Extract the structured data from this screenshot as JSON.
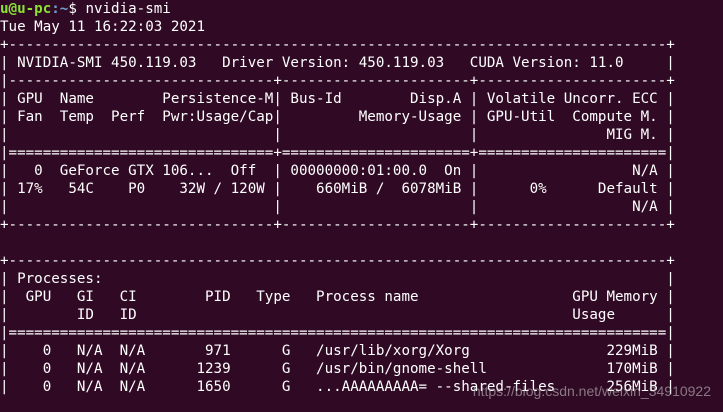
{
  "prompt": {
    "user_host": "u@u-pc",
    "path_symbol": ":~",
    "dollar": "$ ",
    "command": "nvidia-smi"
  },
  "lines": [
    "Tue May 11 16:22:03 2021",
    "+-----------------------------------------------------------------------------+",
    "| NVIDIA-SMI 450.119.03   Driver Version: 450.119.03   CUDA Version: 11.0     |",
    "|-------------------------------+----------------------+----------------------+",
    "| GPU  Name        Persistence-M| Bus-Id        Disp.A | Volatile Uncorr. ECC |",
    "| Fan  Temp  Perf  Pwr:Usage/Cap|         Memory-Usage | GPU-Util  Compute M. |",
    "|                               |                      |               MIG M. |",
    "|===============================+======================+======================|",
    "|   0  GeForce GTX 106...  Off  | 00000000:01:00.0  On |                  N/A |",
    "| 17%   54C    P0    32W / 120W |    660MiB /  6078MiB |      0%      Default |",
    "|                               |                      |                  N/A |",
    "+-------------------------------+----------------------+----------------------+",
    "",
    "+-----------------------------------------------------------------------------+",
    "| Processes:                                                                  |",
    "|  GPU   GI   CI        PID   Type   Process name                  GPU Memory |",
    "|        ID   ID                                                   Usage      |",
    "|=============================================================================|",
    "|    0   N/A  N/A       971      G   /usr/lib/xorg/Xorg                229MiB |",
    "|    0   N/A  N/A      1239      G   /usr/bin/gnome-shell              170MiB |",
    "|    0   N/A  N/A      1650      G   ...AAAAAAAAA= --shared-files      256MiB |"
  ],
  "watermark": "https://blog.csdn.net/weixin_34910922"
}
